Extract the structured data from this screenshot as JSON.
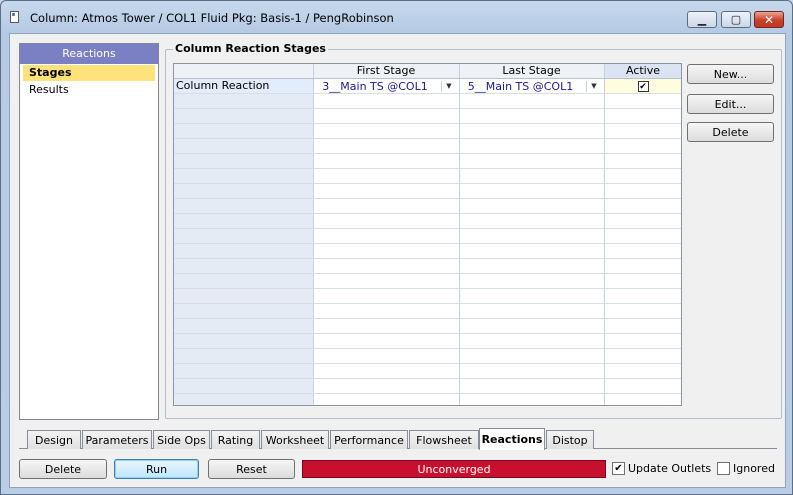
{
  "window": {
    "title": "Column: Atmos Tower / COL1  Fluid Pkg: Basis-1 / PengRobinson",
    "minimize_glyph": "▁",
    "maximize_glyph": "▢",
    "close_glyph": "✕"
  },
  "nav": {
    "header": "Reactions",
    "items": [
      {
        "label": "Stages",
        "selected": true
      },
      {
        "label": "Results",
        "selected": false
      }
    ]
  },
  "group_label": "Column Reaction Stages",
  "grid": {
    "columns": [
      "",
      "First Stage",
      "Last Stage",
      "Active"
    ],
    "rows": [
      {
        "name": "Column Reaction",
        "first_stage": "3__Main TS @COL1",
        "last_stage": "5__Main TS @COL1",
        "active": true
      }
    ],
    "dropdown_glyph": "▼",
    "check_glyph": "✔"
  },
  "side_buttons": {
    "new": "New...",
    "edit": "Edit...",
    "delete": "Delete"
  },
  "tabs": [
    {
      "label": "Design",
      "active": false
    },
    {
      "label": "Parameters",
      "active": false
    },
    {
      "label": "Side Ops",
      "active": false
    },
    {
      "label": "Rating",
      "active": false
    },
    {
      "label": "Worksheet",
      "active": false
    },
    {
      "label": "Performance",
      "active": false
    },
    {
      "label": "Flowsheet",
      "active": false
    },
    {
      "label": "Reactions",
      "active": true
    },
    {
      "label": "Distop",
      "active": false
    }
  ],
  "bottom": {
    "delete": "Delete",
    "run": "Run",
    "reset": "Reset",
    "status": "Unconverged",
    "status_color": "#c8102e",
    "update_outlets_label": "Update Outlets",
    "update_outlets_checked": true,
    "ignored_label": "Ignored",
    "ignored_checked": false
  }
}
